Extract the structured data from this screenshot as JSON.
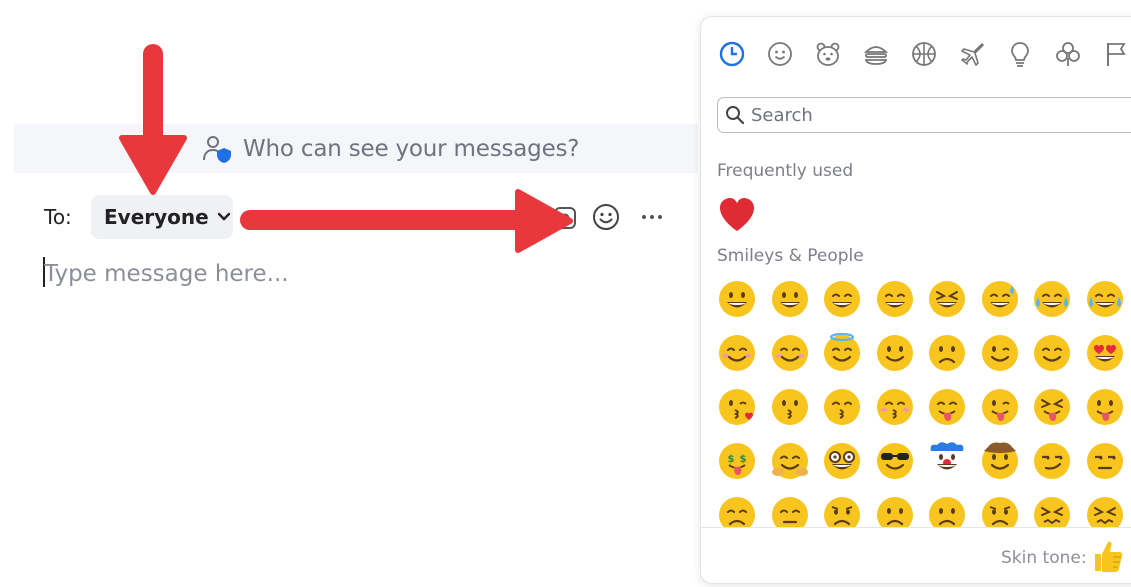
{
  "chat": {
    "privacy_text": "Who can see your messages?",
    "to_label": "To:",
    "recipient": "Everyone",
    "message_placeholder": "Type message here..."
  },
  "emoji_picker": {
    "categories": [
      "recent-icon",
      "smiley-icon",
      "animal-icon",
      "food-icon",
      "sports-icon",
      "travel-icon",
      "lightbulb-icon",
      "symbols-icon",
      "flag-icon"
    ],
    "search_placeholder": "Search",
    "frequently_used_label": "Frequently used",
    "smileys_label": "Smileys & People",
    "skin_tone_label": "Skin tone:",
    "frequently_used": [
      "❤️"
    ],
    "smileys": [
      "😀",
      "😃",
      "😄",
      "😁",
      "😆",
      "😅",
      "😂",
      "🤣",
      "😊",
      "☺️",
      "😇",
      "🙂",
      "🙃",
      "😉",
      "😌",
      "😍",
      "😘",
      "😗",
      "😙",
      "😚",
      "😋",
      "😜",
      "😝",
      "😛",
      "🤑",
      "🤗",
      "🤓",
      "😎",
      "🤡",
      "🤠",
      "😏",
      "😒",
      "😞",
      "😔",
      "😟",
      "😕",
      "🙁",
      "☹️",
      "😣",
      "😖"
    ]
  },
  "colors": {
    "accent": "#1f6fe5",
    "arrow": "#e8383d",
    "emoji_yellow": "#f7c51d"
  }
}
